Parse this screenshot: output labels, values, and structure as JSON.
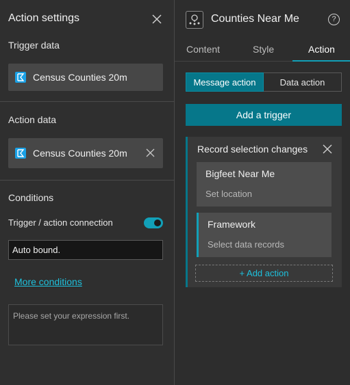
{
  "left": {
    "title": "Action settings",
    "trigger_data": {
      "label": "Trigger data",
      "source": "Census Counties 20m"
    },
    "action_data": {
      "label": "Action data",
      "source": "Census Counties 20m"
    },
    "conditions": {
      "label": "Conditions",
      "connection_label": "Trigger / action connection",
      "connection_on": true,
      "binding_value": "Auto bound.",
      "more_link": "More conditions",
      "expression_placeholder": "Please set your expression first."
    }
  },
  "right": {
    "widget_title": "Counties Near Me",
    "tabs": [
      {
        "label": "Content",
        "active": false
      },
      {
        "label": "Style",
        "active": false
      },
      {
        "label": "Action",
        "active": true
      }
    ],
    "segments": {
      "message": "Message action",
      "data": "Data action"
    },
    "add_trigger": "Add a trigger",
    "trigger_card": {
      "title": "Record selection changes",
      "actions": [
        {
          "name": "Bigfeet Near Me",
          "sub": "Set location"
        },
        {
          "name": "Framework",
          "sub": "Select data records"
        }
      ],
      "add_action": "+ Add action"
    }
  },
  "colors": {
    "accent": "#06778a",
    "link": "#1ec0dc",
    "panel": "#2f2f2f"
  }
}
